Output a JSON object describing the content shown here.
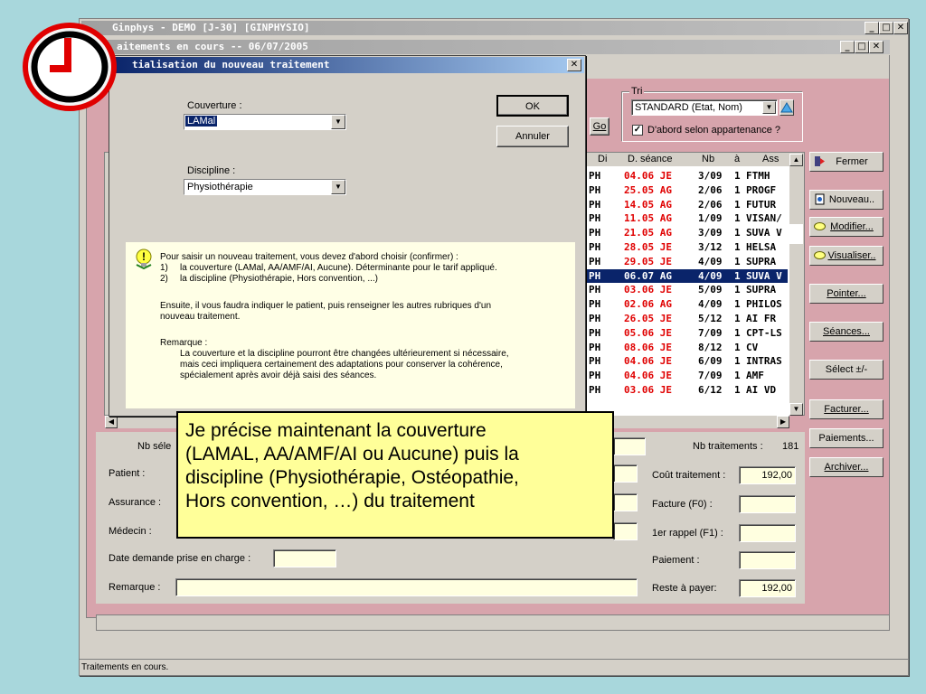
{
  "app": {
    "title": "Ginphys - DEMO [J-30] [GINPHYSIO]",
    "status": "Traitements en cours."
  },
  "child": {
    "title": "aitements en cours  --  06/07/2005"
  },
  "dialog": {
    "title": "tialisation du nouveau traitement",
    "couverture_label": "Couverture :",
    "couverture_value": "LAMal",
    "discipline_label": "Discipline :",
    "discipline_value": "Physiothérapie",
    "ok": "OK",
    "annuler": "Annuler",
    "help": {
      "p1": "Pour saisir un nouveau traitement, vous devez d'abord choisir (confirmer) :",
      "l1n": "1)",
      "l1": "la couverture (LAMal, AA/AMF/AI, Aucune). Déterminante pour le tarif appliqué.",
      "l2n": "2)",
      "l2": "la discipline (Physiothérapie, Hors convention, ...)",
      "p2a": "Ensuite, il vous faudra indiquer le patient, puis renseigner les autres rubriques d'un",
      "p2b": "nouveau traitement.",
      "p3": "Remarque :",
      "p3a": "La couverture et la discipline pourront être changées ultérieurement si nécessaire,",
      "p3b": "mais ceci impliquera certainement des adaptations pour conserver la cohérence,",
      "p3c": "spécialement après avoir déjà saisi des séances."
    }
  },
  "tri": {
    "label": "Tri",
    "value": "STANDARD (Etat, Nom)",
    "checkbox_label": "D'abord selon appartenance ?",
    "checked": true,
    "go": "Go"
  },
  "grid": {
    "headers": [
      "Di",
      "D. séance",
      "Nb",
      "à",
      "Ass"
    ],
    "rows": [
      [
        "PH",
        "04.06 JE",
        "3/09",
        "1",
        "FTMH"
      ],
      [
        "PH",
        "25.05 AG",
        "2/06",
        "1",
        "PROGF"
      ],
      [
        "PH",
        "14.05 AG",
        "2/06",
        "1",
        "FUTUR"
      ],
      [
        "PH",
        "11.05 AG",
        "1/09",
        "1",
        "VISAN/"
      ],
      [
        "PH",
        "21.05 AG",
        "3/09",
        "1",
        "SUVA V"
      ],
      [
        "PH",
        "28.05 JE",
        "3/12",
        "1",
        "HELSA"
      ],
      [
        "PH",
        "29.05 JE",
        "4/09",
        "1",
        "SUPRA"
      ],
      [
        "PH",
        "06.07 AG",
        "4/09",
        "1",
        "SUVA V"
      ],
      [
        "PH",
        "03.06 JE",
        "5/09",
        "1",
        "SUPRA"
      ],
      [
        "PH",
        "02.06 AG",
        "4/09",
        "1",
        "PHILOS"
      ],
      [
        "PH",
        "26.05 JE",
        "5/12",
        "1",
        "AI FR"
      ],
      [
        "PH",
        "05.06 JE",
        "7/09",
        "1",
        "CPT-LS"
      ],
      [
        "PH",
        "08.06 JE",
        "8/12",
        "1",
        "CV"
      ],
      [
        "PH",
        "04.06 JE",
        "6/09",
        "1",
        "INTRAS"
      ],
      [
        "PH",
        "04.06 JE",
        "7/09",
        "1",
        "AMF"
      ],
      [
        "PH",
        "03.06 JE",
        "6/12",
        "1",
        "AI VD"
      ]
    ],
    "selected_index": 7
  },
  "sidebar": {
    "fermer": "Fermer",
    "nouveau": "Nouveau..",
    "modifier": "Modifier...",
    "visualiser": "Visualiser..",
    "pointer": "Pointer...",
    "seances": "Séances...",
    "select": "Sélect ±/-",
    "facturer": "Facturer...",
    "paiements": "Paiements...",
    "archiver": "Archiver..."
  },
  "form": {
    "nb_sel": "Nb séle",
    "patient": "Patient :",
    "assurance": "Assurance :",
    "medecin": "Médecin :",
    "date_demande": "Date demande prise en charge :",
    "remarque": "Remarque :",
    "nb_traitements_label": "Nb traitements :",
    "nb_traitements_value": "181",
    "cout_label": "Coût traitement :",
    "cout_value": "192,00",
    "facture_label": "Facture (F0) :",
    "rappel_label": "1er rappel (F1) :",
    "paiement_label": "Paiement :",
    "reste_label": "Reste à payer:",
    "reste_value": "192,00"
  },
  "tooltip": {
    "l1": "Je précise maintenant la couverture",
    "l2": "(LAMAL, AA/AMF/AI ou Aucune) puis la",
    "l3": "discipline (Physiothérapie, Ostéopathie,",
    "l4": "Hors convention, …) du traitement"
  },
  "colors": {
    "mdi_bg": "#d7a4ac",
    "date_red": "#e00000",
    "selection": "#0a246a",
    "tooltip": "#ffff99"
  }
}
